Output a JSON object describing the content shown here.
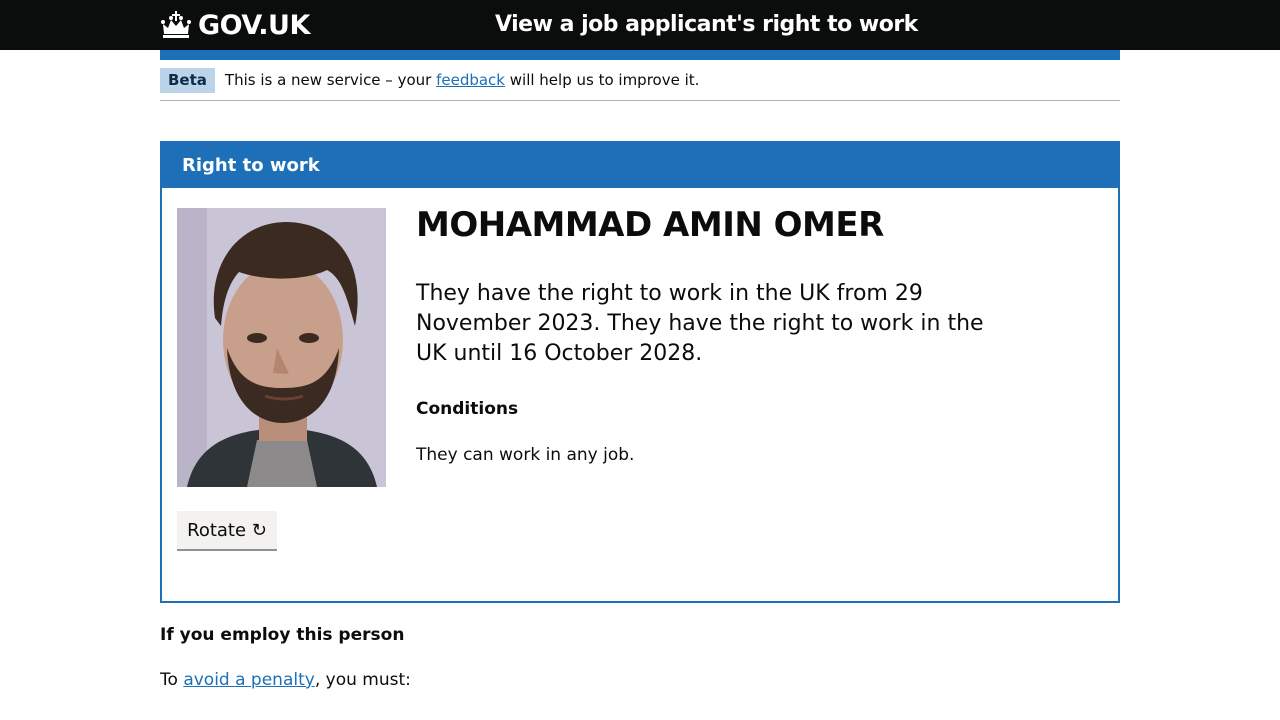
{
  "header": {
    "logo_text": "GOV.UK",
    "service_name": "View a job applicant's right to work"
  },
  "phase_banner": {
    "tag": "Beta",
    "text_before": "This is a new service – your ",
    "link_text": "feedback",
    "text_after": " will help us to improve it."
  },
  "card": {
    "title": "Right to work",
    "person_name": "MOHAMMAD AMIN OMER",
    "status_text": "They have the right to work in the UK from 29 November 2023. They have the right to work in the UK until 16 October 2028.",
    "conditions_heading": "Conditions",
    "conditions_text": "They can work in any job.",
    "rotate_label": "Rotate ↻"
  },
  "employ": {
    "heading": "If you employ this person",
    "text_before": "To ",
    "link_text": "avoid a penalty",
    "text_after": ", you must:"
  },
  "colors": {
    "govuk_blue": "#1d70b8",
    "header_black": "#0b0c0c",
    "beta_tag_bg": "#bbd4ea",
    "button_grey": "#f3f2f1"
  }
}
